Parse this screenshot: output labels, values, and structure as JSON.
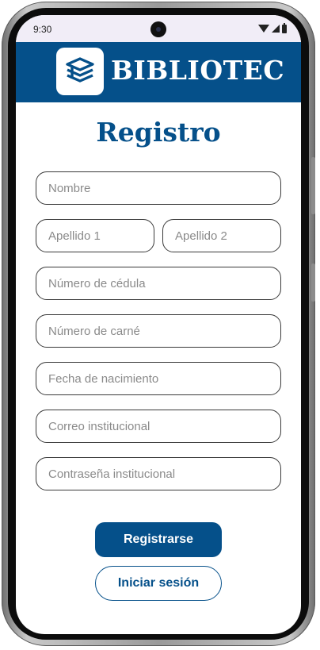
{
  "status_bar": {
    "time": "9:30"
  },
  "header": {
    "brand": "BIBLIOTEC",
    "logo_icon": "books-stack-icon"
  },
  "form": {
    "title": "Registro",
    "fields": {
      "nombre": "Nombre",
      "apellido1": "Apellido 1",
      "apellido2": "Apellido 2",
      "cedula": "Número de cédula",
      "carne": "Número de carné",
      "nacimiento": "Fecha de nacimiento",
      "correo": "Correo institucional",
      "contrasena": "Contraseña institucional"
    },
    "register_label": "Registrarse",
    "login_label": "Iniciar sesión"
  },
  "colors": {
    "primary": "#05508a",
    "status_bar_bg": "#f1edf7"
  }
}
